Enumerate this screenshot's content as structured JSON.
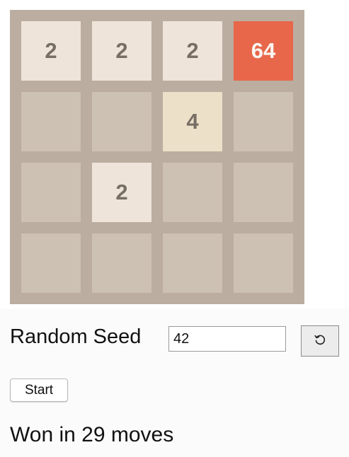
{
  "board": {
    "rows": 4,
    "cols": 4,
    "cells": [
      [
        "2",
        "2",
        "2",
        "64"
      ],
      [
        "",
        "",
        "4",
        ""
      ],
      [
        "",
        "2",
        "",
        ""
      ],
      [
        "",
        "",
        "",
        ""
      ]
    ]
  },
  "controls": {
    "seed_label": "Random Seed",
    "seed_value": "42",
    "reseed_icon": "refresh-icon",
    "start_label": "Start"
  },
  "status": {
    "message": "Won in 29 moves"
  },
  "colors": {
    "board_bg": "#bbada0",
    "empty_cell": "#cdc1b4",
    "tile_2": "#eee4da",
    "tile_4": "#ede0c8",
    "tile_64": "#e8674a",
    "dark_text": "#776e65",
    "light_text": "#f9f6f2"
  }
}
